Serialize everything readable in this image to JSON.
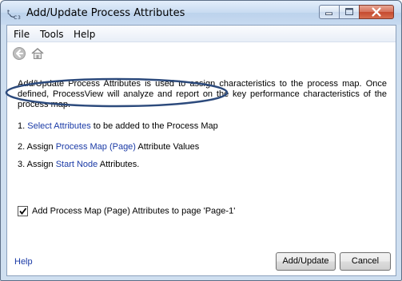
{
  "window": {
    "title": "Add/Update Process Attributes"
  },
  "menu": {
    "file": "File",
    "tools": "Tools",
    "help": "Help"
  },
  "toolbar": {
    "back_icon": "back-arrow-icon",
    "home_icon": "home-icon"
  },
  "description": "Add/Update Process Attributes is used to assign characteristics to the process map.  Once defined, ProcessView will analyze and report on the key performance characteristics of the process map.",
  "steps": [
    {
      "prefix": "1. ",
      "link": "Select Attributes",
      "suffix": " to be added to the Process Map"
    },
    {
      "prefix": "2. Assign ",
      "link": "Process Map (Page)",
      "suffix": " Attribute Values"
    },
    {
      "prefix": "3. Assign ",
      "link": "Start Node",
      "suffix": " Attributes."
    }
  ],
  "checkbox": {
    "label": "Add Process Map (Page) Attributes to page 'Page-1'",
    "checked": true
  },
  "footer": {
    "help": "Help",
    "add_update": "Add/Update",
    "cancel": "Cancel"
  },
  "colors": {
    "link": "#1a3aa6",
    "highlight_ellipse": "#2c4a7c"
  }
}
